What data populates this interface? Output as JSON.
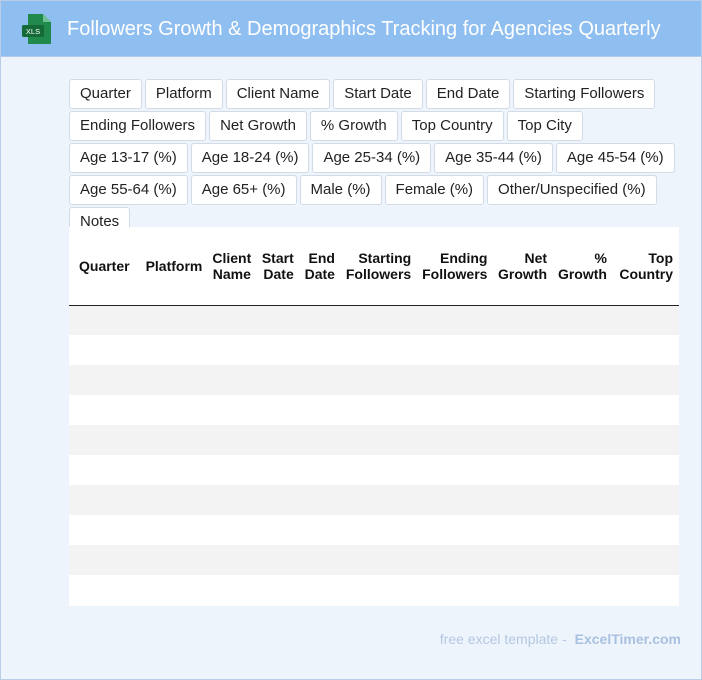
{
  "header": {
    "title": "Followers Growth & Demographics Tracking for Agencies Quarterly",
    "file_icon_label": "XLS",
    "file_icon_color": "#1f8a4c"
  },
  "tags": [
    "Quarter",
    "Platform",
    "Client Name",
    "Start Date",
    "End Date",
    "Starting Followers",
    "Ending Followers",
    "Net Growth",
    "% Growth",
    "Top Country",
    "Top City",
    "Age 13-17 (%)",
    "Age 18-24 (%)",
    "Age 25-34 (%)",
    "Age 35-44 (%)",
    "Age 45-54 (%)",
    "Age 55-64 (%)",
    "Age 65+ (%)",
    "Male (%)",
    "Female (%)",
    "Other/Unspecified (%)",
    "Notes"
  ],
  "table": {
    "columns": [
      {
        "line1": "Quarter",
        "line2": ""
      },
      {
        "line1": "Platform",
        "line2": ""
      },
      {
        "line1": "Client",
        "line2": "Name"
      },
      {
        "line1": "Start",
        "line2": "Date"
      },
      {
        "line1": "End",
        "line2": "Date"
      },
      {
        "line1": "Starting",
        "line2": "Followers"
      },
      {
        "line1": "Ending",
        "line2": "Followers"
      },
      {
        "line1": "Net",
        "line2": "Growth"
      },
      {
        "line1": "%",
        "line2": "Growth"
      },
      {
        "line1": "Top",
        "line2": "Country"
      }
    ],
    "row_count": 10
  },
  "footer": {
    "prefix": "free excel template -",
    "brand": "ExcelTimer.com"
  },
  "colors": {
    "header_bg": "#8fbef0",
    "page_bg": "#eef4fc",
    "stripe": "#f3f3f3"
  }
}
